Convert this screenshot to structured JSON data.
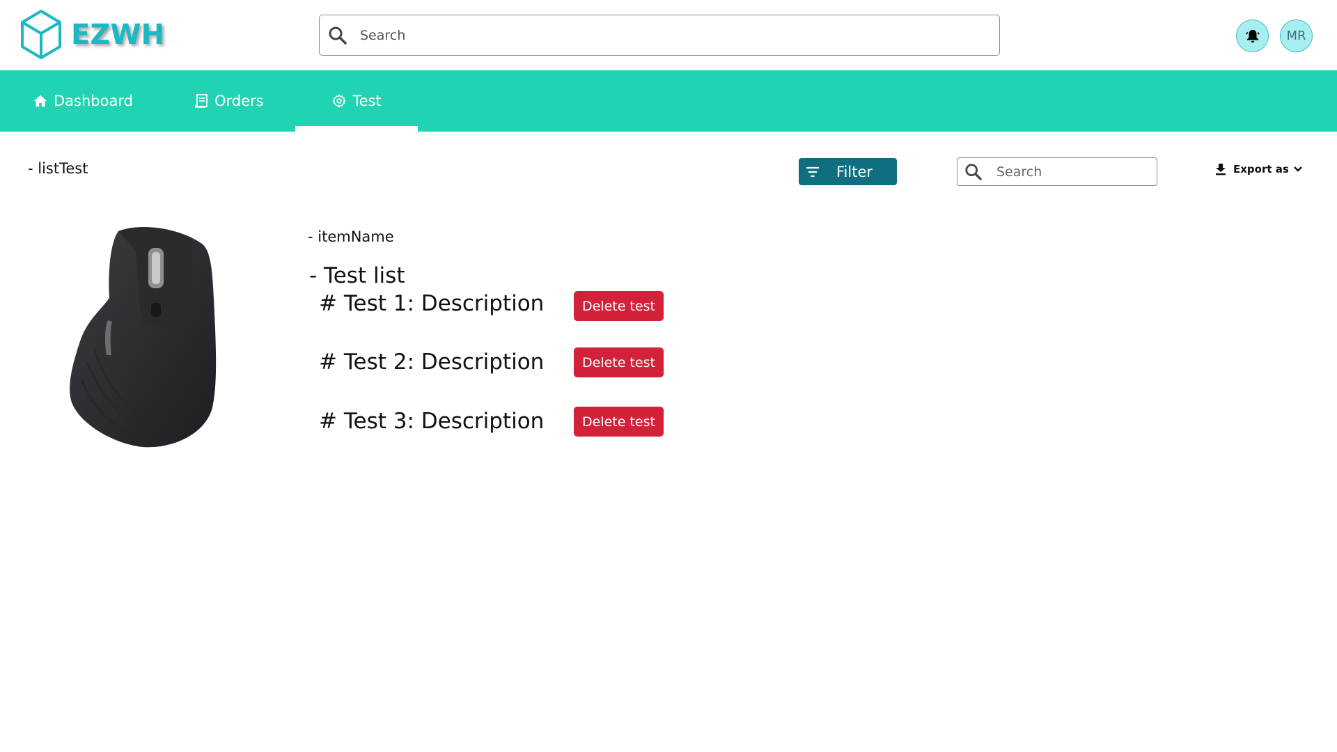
{
  "header": {
    "logo_text": "EZWH",
    "search_placeholder": "Search",
    "avatar_initials": "MR",
    "accent_color": "#1cb8c4"
  },
  "nav": {
    "items": [
      {
        "label": "Dashboard",
        "icon": "home-icon"
      },
      {
        "label": "Orders",
        "icon": "receipt-icon"
      },
      {
        "label": "Test",
        "icon": "gear-icon",
        "active": true
      }
    ],
    "background": "#20d3b2"
  },
  "toolbar": {
    "list_title": "- listTest",
    "filter_label": "Filter",
    "search_placeholder": "Search",
    "export_label": "Export as"
  },
  "content": {
    "item_name": "- itemName",
    "test_list_title": "- Test list",
    "tests": [
      {
        "label": "# Test 1: Description",
        "delete_label": "Delete test"
      },
      {
        "label": "# Test 2: Description",
        "delete_label": "Delete test"
      },
      {
        "label": "# Test 3: Description",
        "delete_label": "Delete test"
      }
    ],
    "delete_color": "#d3213a"
  }
}
